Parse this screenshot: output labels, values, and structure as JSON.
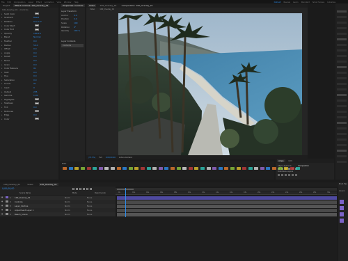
{
  "menu": [
    "File",
    "Edit",
    "Composition",
    "Layer",
    "Effect",
    "Animation",
    "View",
    "Window",
    "Help"
  ],
  "workspaces": [
    "Default",
    "Review",
    "Learn",
    "Standard",
    "Small Screen",
    "Libraries"
  ],
  "effects_panel": {
    "tabs": [
      "Project",
      "Effect Controls: 100_Overlay_01"
    ],
    "comp_label": "100_Overlay_01 • Controls",
    "rows": [
      {
        "label": "Solid Color",
        "value": ""
      },
      {
        "label": "Gradient",
        "value": "Reset"
      },
      {
        "label": "Rotation",
        "value": "0x+0.0°"
      },
      {
        "label": "Color Start",
        "value": ""
      },
      {
        "label": "Color End",
        "value": ""
      },
      {
        "label": "Opacity",
        "value": "100.0%"
      },
      {
        "label": "Blend",
        "value": "Normal"
      },
      {
        "label": "Feather",
        "value": "0.0"
      },
      {
        "label": "Radius",
        "value": "50.0"
      },
      {
        "label": "Offset",
        "value": "0.0"
      },
      {
        "label": "Angle",
        "value": "0.0"
      },
      {
        "label": "Falloff",
        "value": "0.0"
      },
      {
        "label": "Noise",
        "value": "0.0"
      },
      {
        "label": "Grain",
        "value": "0.0"
      },
      {
        "label": "Color Balance",
        "value": "On"
      },
      {
        "label": "Shift",
        "value": "0.0"
      },
      {
        "label": "Hue",
        "value": "0.0"
      },
      {
        "label": "Saturation",
        "value": "0.0"
      },
      {
        "label": "Levels",
        "value": "On"
      },
      {
        "label": "Input",
        "value": "0"
      },
      {
        "label": "Output",
        "value": "255"
      },
      {
        "label": "Gamma",
        "value": "1.00"
      },
      {
        "label": "Highlights",
        "value": ""
      },
      {
        "label": "Shadows",
        "value": ""
      },
      {
        "label": "Tint",
        "value": "0.0"
      },
      {
        "label": "Midtones",
        "value": ""
      },
      {
        "label": "Edge",
        "value": "0.0"
      },
      {
        "label": "Color",
        "value": ""
      }
    ]
  },
  "properties_panel": {
    "tab": "Properties: Controls",
    "header": "Layer Transform",
    "items": [
      {
        "label": "Anchor",
        "value": "0.0"
      },
      {
        "label": "Position",
        "value": "0.0"
      },
      {
        "label": "Scale",
        "value": "100"
      },
      {
        "label": "Rotation",
        "value": "0°"
      },
      {
        "label": "Opacity",
        "value": "100 %"
      }
    ],
    "contents_label": "Layer Contents",
    "contents_item": "Contents"
  },
  "composition": {
    "tabs": [
      "Video",
      "100_Overlay_01",
      "Composition: 100_Overlay_01"
    ],
    "sub_tabs": [
      "Video",
      "100_Overlay_01"
    ],
    "footer_zoom": "(37.5%)",
    "footer_res": "Full",
    "footer_time": "0;00;00;00",
    "footer_camera": "Active Camera"
  },
  "tools_panel": {
    "label": "Filter"
  },
  "right_panel": {
    "tabs": [
      "Align",
      "Info"
    ],
    "section1": "Align Layers to:",
    "dropdown": "Composition",
    "section2": "Distribute Layers"
  },
  "timeline": {
    "tabs": [
      "100_Overlay_01",
      "Video",
      "100_Overlay_01"
    ],
    "timecode": "0;00;00;00",
    "col_source": "Source Name",
    "col_mode": "Mode",
    "col_parent": "Parent & Link",
    "layers": [
      {
        "num": "1",
        "name": "100_Overlay_01",
        "mode": "Norm",
        "parent": "None",
        "color": "#7b63c7"
      },
      {
        "num": "2",
        "name": "Controls",
        "mode": "Norm",
        "parent": "None",
        "color": "#8c8c8c"
      },
      {
        "num": "3",
        "name": "Layer_Outline",
        "mode": "Norm",
        "parent": "None",
        "color": "#8c8c8c"
      },
      {
        "num": "4",
        "name": "Adjustment Layer 1",
        "mode": "Norm",
        "parent": "None",
        "color": "#8c8c8c"
      },
      {
        "num": "5",
        "name": "Beach_Scene",
        "mode": "Norm",
        "parent": "None",
        "color": "#8c8c8c"
      }
    ],
    "ruler": [
      "0s",
      "02s",
      "04s",
      "06s",
      "08s",
      "10s",
      "12s",
      "14s",
      "16s",
      "18s",
      "20s",
      "22s",
      "24s",
      "26s",
      "28s",
      "30s"
    ]
  },
  "far_right": {
    "title": "Brush Tips",
    "sample_label": "PRESETS"
  },
  "colors": {
    "accent": "#2d8ceb",
    "layer_purple": "#7b63c7",
    "timeline_blue": "#4f4aa0"
  }
}
